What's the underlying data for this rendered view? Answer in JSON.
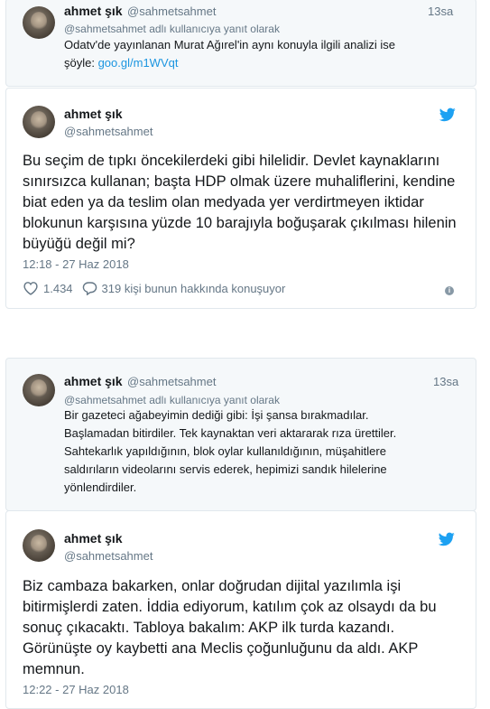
{
  "thread1": {
    "reply": {
      "name": "ahmet şık",
      "handle": "@sahmetsahmet",
      "time": "13sa",
      "replying_to": "@sahmetsahmet adlı kullanıcıya yanıt olarak",
      "text_line1": "Odatv'de yayınlanan Murat Ağırel'in aynı konuyla ilgili analizi ise",
      "text_line2_prefix": "şöyle: ",
      "link": "goo.gl/m1WVqt"
    },
    "tweet": {
      "name": "ahmet şık",
      "handle": "@sahmetsahmet",
      "lines": [
        "Bu seçim de tıpkı öncekilerdeki gibi hilelidir. Devlet kaynaklarını",
        "sınırsızca kullanan; başta HDP olmak üzere muhaliflerini, kendine",
        "biat eden ya da teslim olan medyada yer verdirtmeyen iktidar",
        "blokunun karşısına yüzde 10 barajıyla boğuşarak çıkılması hilenin",
        "büyüğü değil mi?"
      ],
      "date": "12:18 - 27 Haz 2018",
      "likes": "1.434",
      "conversation": "319 kişi bunun hakkında konuşuyor"
    }
  },
  "thread2": {
    "reply": {
      "name": "ahmet şık",
      "handle": "@sahmetsahmet",
      "time": "13sa",
      "replying_to": "@sahmetsahmet adlı kullanıcıya yanıt olarak",
      "lines": [
        "Bir gazeteci ağabeyimin dediği gibi: İşi şansa bırakmadılar.",
        "Başlamadan bitirdiler. Tek kaynaktan veri aktararak rıza ürettiler.",
        "Sahtekarlık yapıldığının, blok oylar kullanıldığının, müşahitlere",
        "saldırıların videolarını servis ederek, hepimizi sandık hilelerine",
        "yönlendirdiler."
      ]
    },
    "tweet": {
      "name": "ahmet şık",
      "handle": "@sahmetsahmet",
      "lines": [
        "Biz cambaza bakarken, onlar doğrudan dijital yazılımla işi",
        "bitirmişlerdi zaten. İddia ediyorum, katılım çok az olsaydı da bu",
        "sonuç çıkacaktı. Tabloya bakalım: AKP ilk turda kazandı.",
        "Görünüşte oy kaybetti ana Meclis çoğunluğunu da aldı. AKP",
        "memnun."
      ],
      "date": "12:22 - 27 Haz 2018"
    }
  },
  "colors": {
    "link": "#1b95e0",
    "twitter_blue": "#1da1f2",
    "muted": "#657786"
  },
  "icons": [
    "twitter-bird-icon",
    "heart-icon",
    "reply-bubble-icon",
    "info-icon"
  ]
}
